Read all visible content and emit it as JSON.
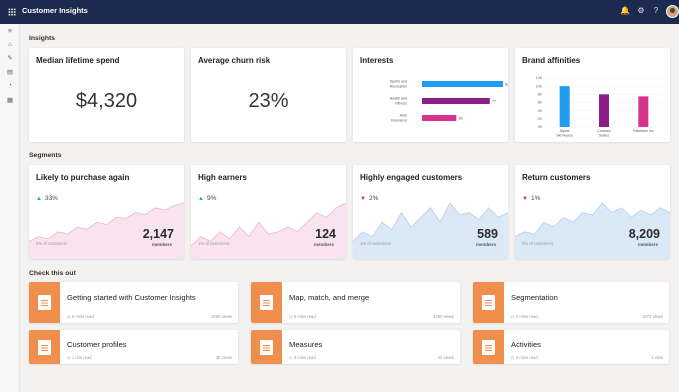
{
  "app": {
    "title": "Customer Insights"
  },
  "topbar_icons": [
    "bell-icon",
    "gear-icon",
    "help-icon"
  ],
  "topbar_glyphs": {
    "bell": "🔔",
    "gear": "⚙",
    "help": "?"
  },
  "nav_icons": [
    "hamburger-icon",
    "home-icon",
    "pencil-icon",
    "document-icon",
    "pie-icon",
    "notes-icon"
  ],
  "nav_glyphs": [
    "≡",
    "⌂",
    "✎",
    "▤",
    "◔",
    "▦"
  ],
  "insights": {
    "section_title": "Insights",
    "median_spend": {
      "title": "Median lifetime spend",
      "value": "$4,320"
    },
    "churn": {
      "title": "Average churn risk",
      "value": "23%"
    },
    "interests": {
      "title": "Interests",
      "chart_data": {
        "type": "bar",
        "orientation": "horizontal",
        "categories": [
          "Sports and Recreation",
          "Health and Fitness",
          "Auto Insurance"
        ],
        "values": [
          92,
          77,
          39
        ],
        "xlim": [
          0,
          100
        ],
        "colors": [
          "#1f9bf0",
          "#8b1f85",
          "#d6338a"
        ]
      }
    },
    "brand_affinities": {
      "title": "Brand affinities",
      "chart_data": {
        "type": "bar",
        "categories": [
          "Alpine Ski House",
          "Contoso Suites",
          "Fabrikam Inc"
        ],
        "values": [
          10,
          8,
          7.5
        ],
        "ylim": [
          0,
          12
        ],
        "yticks": [
          "12K",
          "10K",
          "8K",
          "6K",
          "4K",
          "2K",
          "0K"
        ],
        "colors": [
          "#1f9bf0",
          "#8b1f85",
          "#d6338a"
        ]
      }
    }
  },
  "segments": {
    "section_title": "Segments",
    "cards": [
      {
        "title": "Likely to purchase again",
        "trend": "33%",
        "direction": "up",
        "note": "0% of customers",
        "count": "2,147",
        "unit": "members",
        "color": "#f9e3ee",
        "stroke": "#e7b8cf",
        "series": [
          2,
          3,
          2.5,
          4,
          3.5,
          5,
          4.5,
          6,
          5.5,
          7,
          6.8,
          8,
          7.6,
          9,
          8.5,
          9.5,
          10
        ]
      },
      {
        "title": "High earners",
        "trend": "9%",
        "direction": "up",
        "note": "1% of customers",
        "count": "124",
        "unit": "members",
        "color": "#f9e3ee",
        "stroke": "#e7b8cf",
        "series": [
          1,
          3,
          2,
          4,
          2.5,
          5,
          3,
          6,
          3.5,
          4,
          5,
          4,
          6,
          8,
          7,
          9,
          10
        ]
      },
      {
        "title": "Highly engaged customers",
        "trend": "2%",
        "direction": "down",
        "note": "1% of customers",
        "count": "589",
        "unit": "members",
        "color": "#dbe9f7",
        "stroke": "#b3cfe9",
        "series": [
          2,
          4,
          3,
          6,
          4.5,
          8,
          5,
          7,
          9,
          6,
          10,
          7.5,
          8,
          6.5,
          9,
          7,
          8
        ]
      },
      {
        "title": "Return customers",
        "trend": "1%",
        "direction": "down",
        "note": "0% of customers",
        "count": "8,209",
        "unit": "members",
        "color": "#dbe9f7",
        "stroke": "#b3cfe9",
        "series": [
          3,
          4,
          3.5,
          6,
          5,
          7,
          6,
          8,
          7.5,
          10,
          8,
          9,
          7,
          8.5,
          7.5,
          9,
          8
        ]
      }
    ]
  },
  "check_this_out": {
    "section_title": "Check this out",
    "tiles": [
      {
        "title": "Getting started with Customer Insights",
        "read": "5 mins read",
        "views": "1080 views"
      },
      {
        "title": "Map, match, and merge",
        "read": "5 mins read",
        "views": "2460 views"
      },
      {
        "title": "Segmentation",
        "read": "2 mins read",
        "views": "1072 views"
      },
      {
        "title": "Customer profiles",
        "read": "1 min read",
        "views": "30 views"
      },
      {
        "title": "Measures",
        "read": "3 mins read",
        "views": "22 views"
      },
      {
        "title": "Activities",
        "read": "2 mins read",
        "views": "1 view"
      }
    ]
  }
}
